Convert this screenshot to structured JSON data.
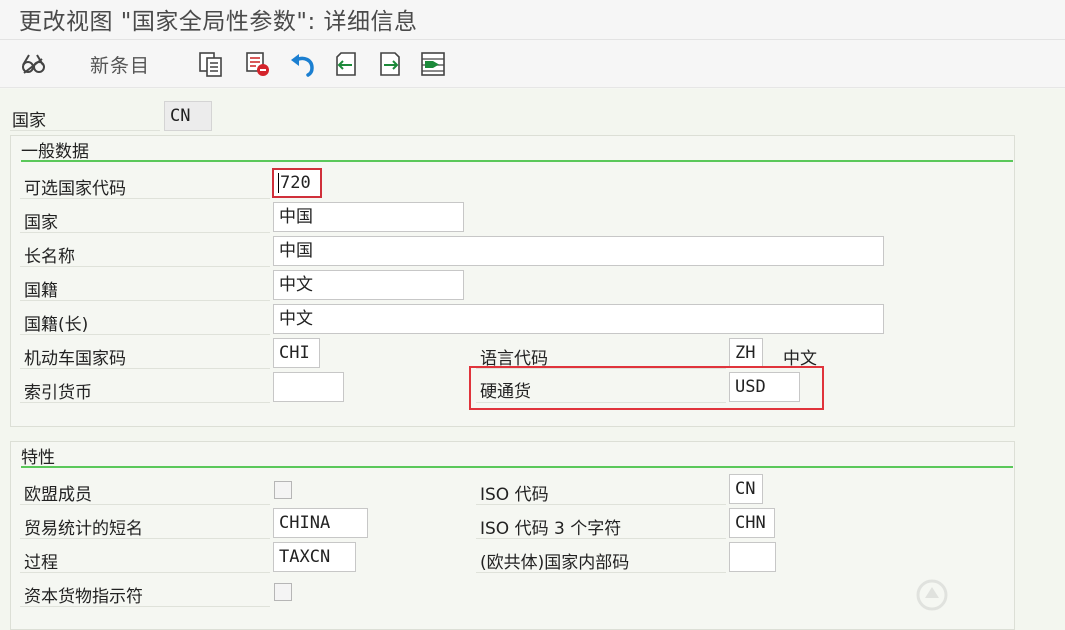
{
  "window": {
    "title": "更改视图 \"国家全局性参数\": 详细信息"
  },
  "toolbar": {
    "new_entry_label": "新条目",
    "icons": [
      "glasses-icon",
      "copy-icon",
      "delete-icon",
      "undo-icon",
      "previous-entry-icon",
      "next-entry-icon",
      "select-all-icon"
    ]
  },
  "header": {
    "country_label": "国家",
    "country_value": "CN"
  },
  "general": {
    "title": "一般数据",
    "alt_code_label": "可选国家代码",
    "alt_code_value": "720",
    "country_name_label": "国家",
    "country_name_value": "中国",
    "long_name_label": "长名称",
    "long_name_value": "中国",
    "nationality_label": "国籍",
    "nationality_value": "中文",
    "nationality_long_label": "国籍(长)",
    "nationality_long_value": "中文",
    "vehicle_code_label": "机动车国家码",
    "vehicle_code_value": "CHI",
    "language_code_label": "语言代码",
    "language_code_value": "ZH",
    "language_name": "中文",
    "index_currency_label": "索引货币",
    "index_currency_value": "",
    "hard_currency_label": "硬通货",
    "hard_currency_value": "USD"
  },
  "properties": {
    "title": "特性",
    "eu_member_label": "欧盟成员",
    "eu_member_checked": false,
    "iso_code_label": "ISO 代码",
    "iso_code_value": "CN",
    "trade_stats_label": "贸易统计的短名",
    "trade_stats_value": "CHINA",
    "iso3_label": "ISO 代码 3 个字符",
    "iso3_value": "CHN",
    "procedure_label": "过程",
    "procedure_value": "TAXCN",
    "eu_internal_label": "(欧共体)国家内部码",
    "eu_internal_value": "",
    "capital_goods_label": "资本货物指示符",
    "capital_goods_checked": false
  },
  "colors": {
    "accent_rule": "#5ac85a",
    "highlight": "#e0343c",
    "focus": "#d0303a"
  }
}
